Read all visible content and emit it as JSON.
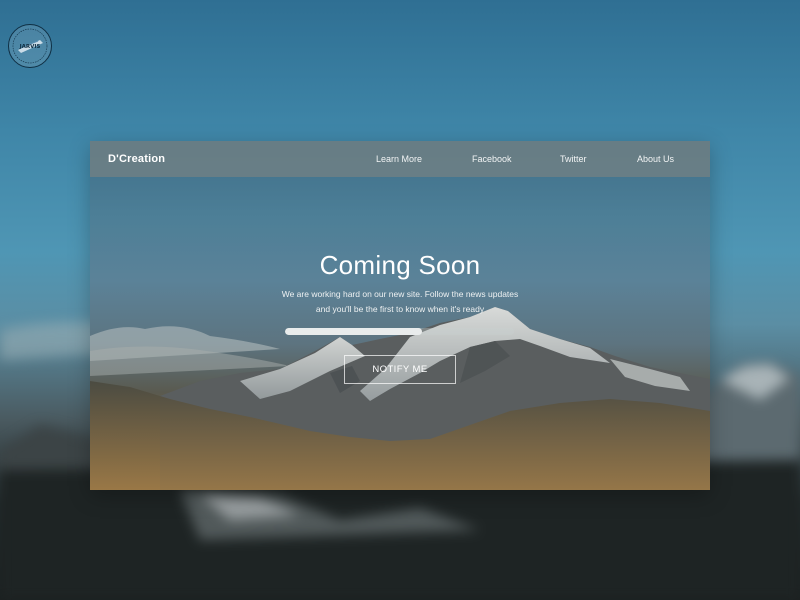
{
  "badge": {
    "text": "JARVIS",
    "ring_text": "DESIGNED BY"
  },
  "navbar": {
    "brand": "D'Creation",
    "links": [
      {
        "label": "Learn More"
      },
      {
        "label": "Facebook"
      },
      {
        "label": "Twitter"
      },
      {
        "label": "About Us"
      }
    ]
  },
  "hero": {
    "title": "Coming Soon",
    "subtitle_line1": "We are working hard on our new site. Follow the news updates",
    "subtitle_line2": "and you'll be the first to know when it's ready",
    "progress_percent": 60,
    "button_label": "NOTIFY ME"
  },
  "colors": {
    "sky": "#4f96b4",
    "navbar": "#708084",
    "progress_fill": "#e9ecec",
    "ground": "#957547"
  },
  "icons": {
    "badge": "logo-badge-icon"
  }
}
